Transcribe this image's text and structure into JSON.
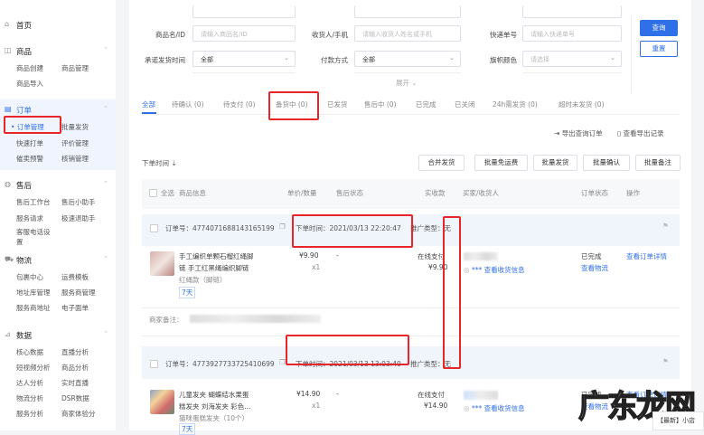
{
  "sidebar": {
    "home": "首页",
    "sections": [
      {
        "title": "商品",
        "icon": "bag-icon",
        "items": [
          "商品创建",
          "商品管理",
          "商品导入"
        ]
      },
      {
        "title": "订单",
        "icon": "clipboard-icon",
        "items": [
          "订单管理",
          "批量发货",
          "快速打单",
          "评价管理",
          "催卖预警",
          "核销管理"
        ]
      },
      {
        "title": "售后",
        "icon": "headset-icon",
        "items": [
          "售后工作台",
          "售后小助手",
          "服务请求",
          "极速退助手",
          "客服电话设置"
        ]
      },
      {
        "title": "物流",
        "icon": "truck-icon",
        "items": [
          "包裹中心",
          "运费模板",
          "地址库管理",
          "服务商管理",
          "服务商地址",
          "电子面单"
        ]
      },
      {
        "title": "数据",
        "icon": "chart-icon",
        "items": [
          "核心数据",
          "直播分析",
          "短视频分析",
          "商品分析",
          "达人分析",
          "实时直播",
          "物流分析",
          "DSR数据",
          "服务分析",
          "商家体验分"
        ]
      }
    ]
  },
  "filters": {
    "product_label": "商品名/ID",
    "product_placeholder": "请输入商品名/ID",
    "receiver_label": "收货人/手机",
    "receiver_placeholder": "请输入收货人姓名或手机",
    "express_label": "快递单号",
    "express_placeholder": "请输入快递单号",
    "ship_time_label": "承诺发货时间",
    "ship_time_value": "全部",
    "pay_label": "付款方式",
    "pay_value": "全部",
    "flag_label": "旗帜颜色",
    "flag_placeholder": "请选择",
    "expand": "展开",
    "query": "查询",
    "reset": "重置"
  },
  "tabs": [
    "全部",
    "待确认 (0)",
    "待支付 (0)",
    "备货中 (0)",
    "已发货",
    "售后中 (0)",
    "已完成",
    "已关闭",
    "24h需发货 (0)",
    "超时未发货 (0)"
  ],
  "export": {
    "export_orders": "导出查询订单",
    "export_records": "查看导出记录"
  },
  "sort_label": "下单时间 ⇣",
  "actions": [
    "合并发货",
    "批量免运费",
    "批量发货",
    "批量确认",
    "批量备注"
  ],
  "columns": {
    "select_all": "全选",
    "product": "商品信息",
    "price_qty": "单价/数量",
    "after_sale": "售后状态",
    "paid": "实收款",
    "buyer": "买家/收货人",
    "status": "订单状态",
    "ops": "操作"
  },
  "orders": [
    {
      "order_no": "订单号：4774071688143165199",
      "time": "下单时间：2021/03/13 22:20:47",
      "promo": "推广类型：无",
      "title1": "手工编织单颗石榴红绳脚",
      "title2": "链 手工红黑绳编织脚链",
      "sku": "红绳款（脚链）",
      "tag": "7天",
      "price": "¥9.90",
      "qty": "x1",
      "after_sale": "-",
      "pay_method": "在线支付",
      "paid": "¥9.90",
      "receiver": "*** 查看收货信息",
      "status": "已完成",
      "logistics": "查看物流",
      "detail": "查看订单详情"
    },
    {
      "order_no": "订单号：4773927733725410699",
      "time": "下单时间：2021/03/13 13:03:40",
      "promo": "推广类型：无",
      "title1": "儿童发夹 蝴蝶结水果蛋",
      "title2": "糕发夹 刘海发夹 彩色...",
      "sku": "猫咪蛋糕发夹（10个）",
      "tag": "7天",
      "price": "¥14.90",
      "qty": "x1",
      "after_sale": "-",
      "pay_method": "在线支付",
      "paid": "¥14.90",
      "receiver": "*** 查看收货信息",
      "status": "已完成",
      "logistics": "查看物流",
      "detail": "查看订单详情"
    }
  ],
  "merchant_note_label": "商家备注：",
  "watermark": "广东龙网",
  "notice": "【最新】小店"
}
